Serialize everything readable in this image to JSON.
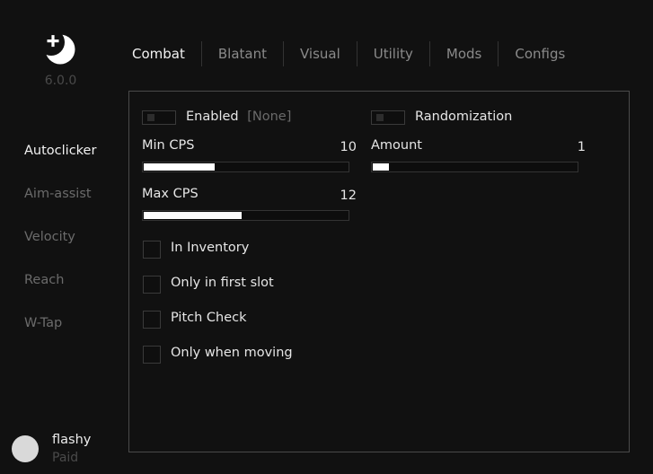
{
  "app": {
    "version": "6.0.0",
    "logo_icon": "moon-plus-icon"
  },
  "sidebar": {
    "items": [
      {
        "label": "Autoclicker",
        "active": true
      },
      {
        "label": "Aim-assist",
        "active": false
      },
      {
        "label": "Velocity",
        "active": false
      },
      {
        "label": "Reach",
        "active": false
      },
      {
        "label": "W-Tap",
        "active": false
      }
    ]
  },
  "user": {
    "name": "flashy",
    "tier": "Paid"
  },
  "tabs": [
    {
      "label": "Combat",
      "active": true
    },
    {
      "label": "Blatant",
      "active": false
    },
    {
      "label": "Visual",
      "active": false
    },
    {
      "label": "Utility",
      "active": false
    },
    {
      "label": "Mods",
      "active": false
    },
    {
      "label": "Configs",
      "active": false
    }
  ],
  "module": {
    "enabled": {
      "label": "Enabled",
      "keybind": "[None]",
      "on": false
    },
    "randomization": {
      "label": "Randomization",
      "on": false
    },
    "min_cps": {
      "label": "Min CPS",
      "value": "10",
      "fraction": 0.35
    },
    "max_cps": {
      "label": "Max CPS",
      "value": "12",
      "fraction": 0.48
    },
    "amount": {
      "label": "Amount",
      "value": "1",
      "fraction": 0.08
    },
    "checkboxes": [
      {
        "label": "In Inventory",
        "checked": false
      },
      {
        "label": "Only in first slot",
        "checked": false
      },
      {
        "label": "Pitch Check",
        "checked": false
      },
      {
        "label": "Only when moving",
        "checked": false
      }
    ]
  },
  "colors": {
    "background": "#111111",
    "text_active": "#f2f2f2",
    "text_muted": "#6b6b6b",
    "accent_fill": "#ffffff"
  }
}
